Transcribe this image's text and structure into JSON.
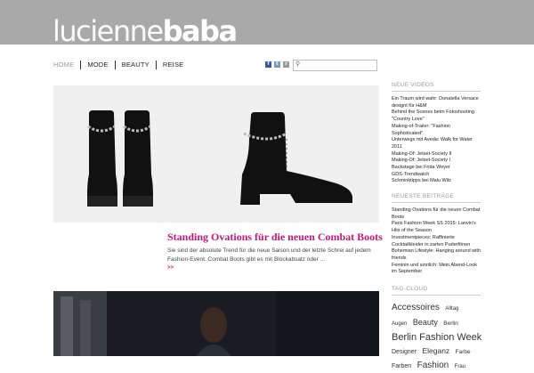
{
  "logo": {
    "light": "lucienne",
    "bold": "baba"
  },
  "nav": [
    {
      "label": "HOME"
    },
    {
      "label": "MODE"
    },
    {
      "label": "BEAUTY"
    },
    {
      "label": "REISE"
    }
  ],
  "social": {
    "facebook": "f",
    "twitter": "t",
    "rss": "r"
  },
  "search": {
    "icon": "search-icon",
    "value": ""
  },
  "featured": {
    "title": "Standing Ovations für die neuen Combat Boots",
    "excerpt": "Sie sind der absolute Trend für die neue Saison und der letzte Schrei auf jedem Fashion-Event. Combat Boots gibt es mit Blockabsatz oder ...",
    "more": ">>"
  },
  "sidebar": {
    "videos_title": "NEUE VIDEOS",
    "videos": [
      "Ein Traum wird wahr: Donatella Versace designt für H&M",
      "Behind the Scenes beim Fotoshooting \"Country Love\"",
      "Making-of-Trailer: \"Fashion Sophisticated\"",
      "Unterwegs mit Aveda: Walk for Water 2011",
      "Making-Of: Jetset-Society II",
      "Making-Of: Jetset-Society I",
      "Backstage bei Frida Weyer",
      "GDS-Trendwatch",
      "Schminktipps bei Malu Wilz"
    ],
    "posts_title": "NEUESTE BEITRÄGE",
    "posts": [
      "Standing Ovations für die neuen Combat Boots",
      "Paris Fashion Week SS 2015: Lanvin's Hits of the Season",
      "Investmentpieces: Raffinierte Cocktailkleider in zarten Puderfönen",
      "Bohemian Lifestyle: Hanging around with friends",
      "Feminin und sinnlich: Mein Abend-Look im September"
    ],
    "tags_title": "TAG-CLOUD",
    "tags": [
      {
        "label": "Accessoires",
        "size": 10
      },
      {
        "label": "Alltag",
        "size": 6
      },
      {
        "label": "Augen",
        "size": 6
      },
      {
        "label": "Beauty",
        "size": 9
      },
      {
        "label": "Berlin",
        "size": 6.5
      },
      {
        "label": "Berlin Fashion Week",
        "size": 11
      },
      {
        "label": "Designer",
        "size": 7
      },
      {
        "label": "Eleganz",
        "size": 8.5
      },
      {
        "label": "Farbe",
        "size": 6.5
      },
      {
        "label": "Farben",
        "size": 7
      },
      {
        "label": "Fashion",
        "size": 10
      },
      {
        "label": "Frau",
        "size": 6
      }
    ]
  },
  "colors": {
    "header": "#a9a9a9",
    "accent": "#c4197b"
  }
}
